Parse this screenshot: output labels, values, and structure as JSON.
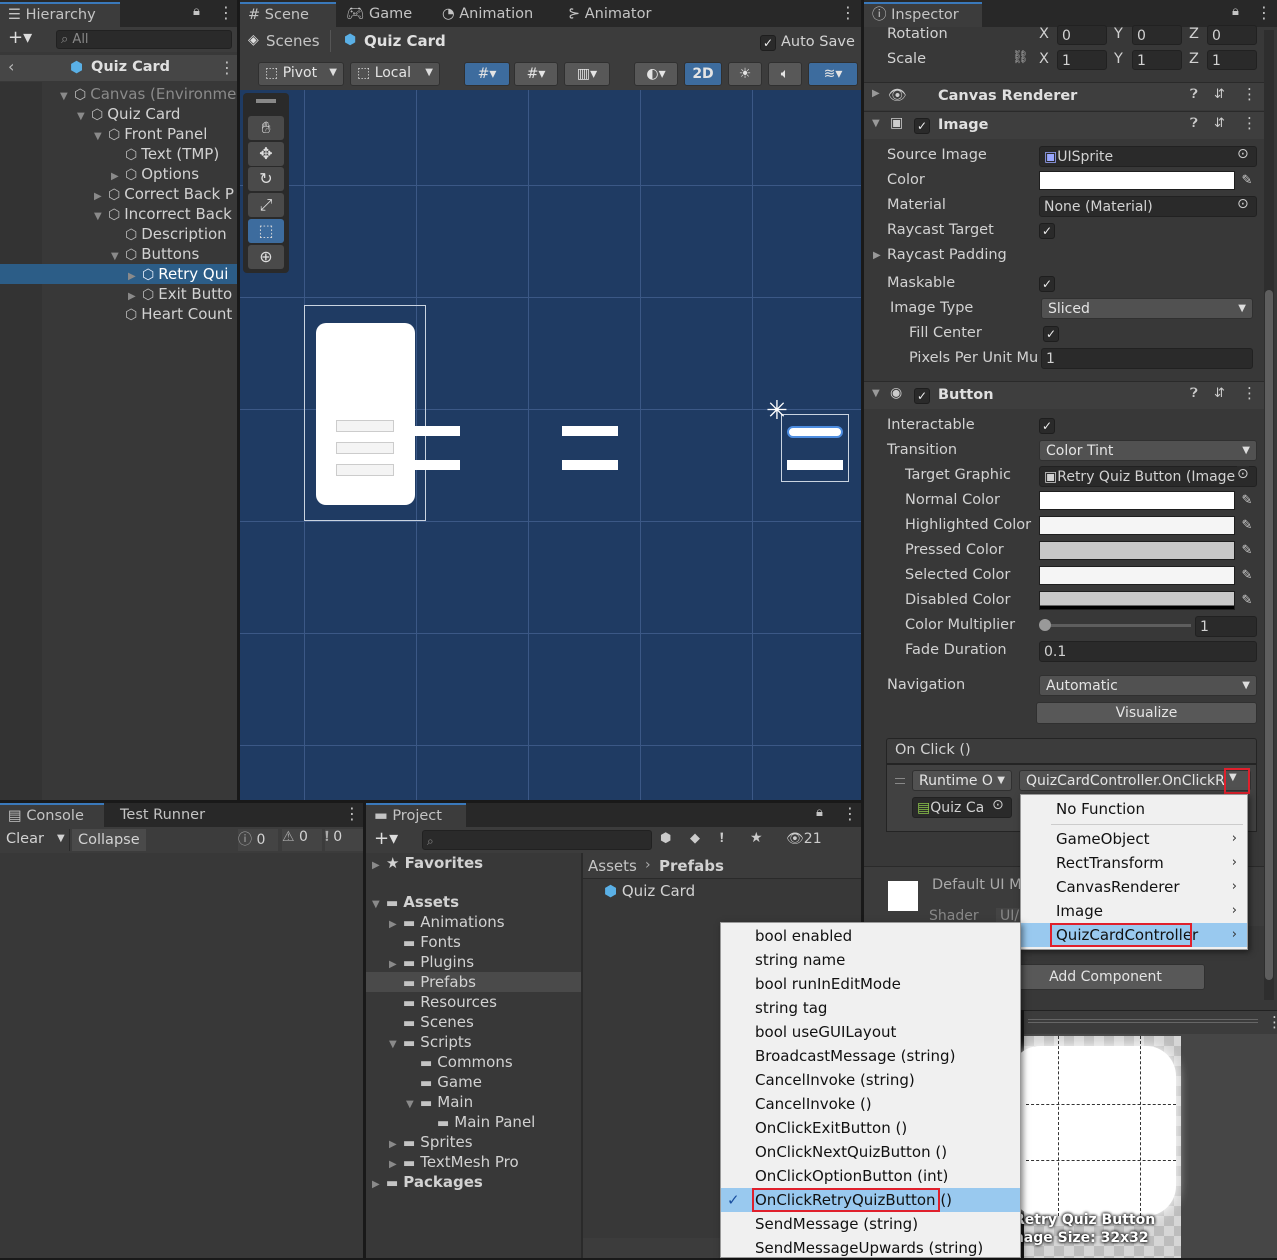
{
  "hierarchy": {
    "tab": "Hierarchy",
    "search_placeholder": "All",
    "scene_title": "Quiz Card",
    "items": [
      {
        "label": "Canvas (Environme",
        "depth": 0,
        "fold": "open",
        "dim": true
      },
      {
        "label": "Quiz Card",
        "depth": 1,
        "fold": "open"
      },
      {
        "label": "Front Panel",
        "depth": 2,
        "fold": "open"
      },
      {
        "label": "Text (TMP)",
        "depth": 3,
        "fold": "none"
      },
      {
        "label": "Options",
        "depth": 3,
        "fold": "closed"
      },
      {
        "label": "Correct Back P",
        "depth": 2,
        "fold": "closed"
      },
      {
        "label": "Incorrect Back",
        "depth": 2,
        "fold": "open"
      },
      {
        "label": "Description",
        "depth": 3,
        "fold": "none"
      },
      {
        "label": "Buttons",
        "depth": 3,
        "fold": "open"
      },
      {
        "label": "Retry Qui",
        "depth": 4,
        "fold": "closed",
        "selected": true
      },
      {
        "label": "Exit Butto",
        "depth": 4,
        "fold": "closed"
      },
      {
        "label": "Heart Count",
        "depth": 3,
        "fold": "none"
      }
    ]
  },
  "scene": {
    "tabs": [
      "Scene",
      "Game",
      "Animation",
      "Animator"
    ],
    "breadcrumb_root": "Scenes",
    "breadcrumb_current": "Quiz Card",
    "auto_save": "Auto Save",
    "pivot": "Pivot",
    "local": "Local",
    "mode_2d": "2D"
  },
  "inspector": {
    "tab": "Inspector",
    "rotation": {
      "label": "Rotation",
      "x": "0",
      "y": "0",
      "z": "0"
    },
    "scale": {
      "label": "Scale",
      "x": "1",
      "y": "1",
      "z": "1"
    },
    "axis_x": "X",
    "axis_y": "Y",
    "axis_z": "Z",
    "canvas_renderer": "Canvas Renderer",
    "image": {
      "title": "Image",
      "source_image_label": "Source Image",
      "source_image": "UISprite",
      "color_label": "Color",
      "material_label": "Material",
      "material": "None (Material)",
      "raycast_target_label": "Raycast Target",
      "raycast_padding_label": "Raycast Padding",
      "maskable_label": "Maskable",
      "image_type_label": "Image Type",
      "image_type": "Sliced",
      "fill_center_label": "Fill Center",
      "ppu_label": "Pixels Per Unit Mu",
      "ppu": "1"
    },
    "button": {
      "title": "Button",
      "interactable_label": "Interactable",
      "transition_label": "Transition",
      "transition": "Color Tint",
      "target_graphic_label": "Target Graphic",
      "target_graphic": "Retry Quiz Button (Image",
      "normal_color_label": "Normal Color",
      "highlighted_color_label": "Highlighted Color",
      "pressed_color_label": "Pressed Color",
      "selected_color_label": "Selected Color",
      "disabled_color_label": "Disabled Color",
      "color_multiplier_label": "Color Multiplier",
      "color_multiplier": "1",
      "fade_duration_label": "Fade Duration",
      "fade_duration": "0.1",
      "navigation_label": "Navigation",
      "navigation": "Automatic",
      "visualize": "Visualize",
      "onclick_title": "On Click ()",
      "runtime": "Runtime O",
      "function": "QuizCardController.OnClickR",
      "object": "Quiz Ca"
    },
    "material_preview": {
      "name": "Default UI M",
      "shader": "Shader",
      "shader_value": "UI/"
    },
    "add_component": "Add Component",
    "preview_caption_1": "Retry Quiz Button",
    "preview_caption_2": "Image Size: 32x32"
  },
  "menu_top": {
    "items": [
      {
        "label": "No Function",
        "sub": false
      },
      {
        "label": "GameObject",
        "sub": true
      },
      {
        "label": "RectTransform",
        "sub": true
      },
      {
        "label": "CanvasRenderer",
        "sub": true
      },
      {
        "label": "Image",
        "sub": true
      },
      {
        "label": "QuizCardController",
        "sub": true,
        "highlight": true
      }
    ]
  },
  "menu_sub": {
    "items": [
      {
        "label": "bool enabled"
      },
      {
        "label": "string name"
      },
      {
        "label": "bool runInEditMode"
      },
      {
        "label": "string tag"
      },
      {
        "label": "bool useGUILayout"
      },
      {
        "label": "BroadcastMessage (string)"
      },
      {
        "label": "CancelInvoke (string)"
      },
      {
        "label": "CancelInvoke ()"
      },
      {
        "label": "OnClickExitButton ()"
      },
      {
        "label": "OnClickNextQuizButton ()"
      },
      {
        "label": "OnClickOptionButton (int)"
      },
      {
        "label": "OnClickRetryQuizButton ()",
        "selected": true
      },
      {
        "label": "SendMessage (string)"
      },
      {
        "label": "SendMessageUpwards (string)"
      }
    ]
  },
  "console": {
    "tabs": [
      "Console",
      "Test Runner"
    ],
    "clear": "Clear",
    "collapse": "Collapse",
    "count_info": "0",
    "count_warn": "0",
    "count_error": "0"
  },
  "project": {
    "tab": "Project",
    "count": "21",
    "favorites": "Favorites",
    "tree": [
      {
        "label": "Assets",
        "depth": 0,
        "fold": "open",
        "bold": true
      },
      {
        "label": "Animations",
        "depth": 1,
        "fold": "closed"
      },
      {
        "label": "Fonts",
        "depth": 1,
        "fold": "none"
      },
      {
        "label": "Plugins",
        "depth": 1,
        "fold": "closed"
      },
      {
        "label": "Prefabs",
        "depth": 1,
        "fold": "none",
        "selected": true
      },
      {
        "label": "Resources",
        "depth": 1,
        "fold": "none"
      },
      {
        "label": "Scenes",
        "depth": 1,
        "fold": "none"
      },
      {
        "label": "Scripts",
        "depth": 1,
        "fold": "open"
      },
      {
        "label": "Commons",
        "depth": 2,
        "fold": "none"
      },
      {
        "label": "Game",
        "depth": 2,
        "fold": "none"
      },
      {
        "label": "Main",
        "depth": 2,
        "fold": "open"
      },
      {
        "label": "Main Panel",
        "depth": 3,
        "fold": "none"
      },
      {
        "label": "Sprites",
        "depth": 1,
        "fold": "closed"
      },
      {
        "label": "TextMesh Pro",
        "depth": 1,
        "fold": "closed"
      },
      {
        "label": "Packages",
        "depth": 0,
        "fold": "closed",
        "bold": true
      }
    ],
    "breadcrumb_root": "Assets",
    "breadcrumb_current": "Prefabs",
    "asset": "Quiz Card"
  }
}
